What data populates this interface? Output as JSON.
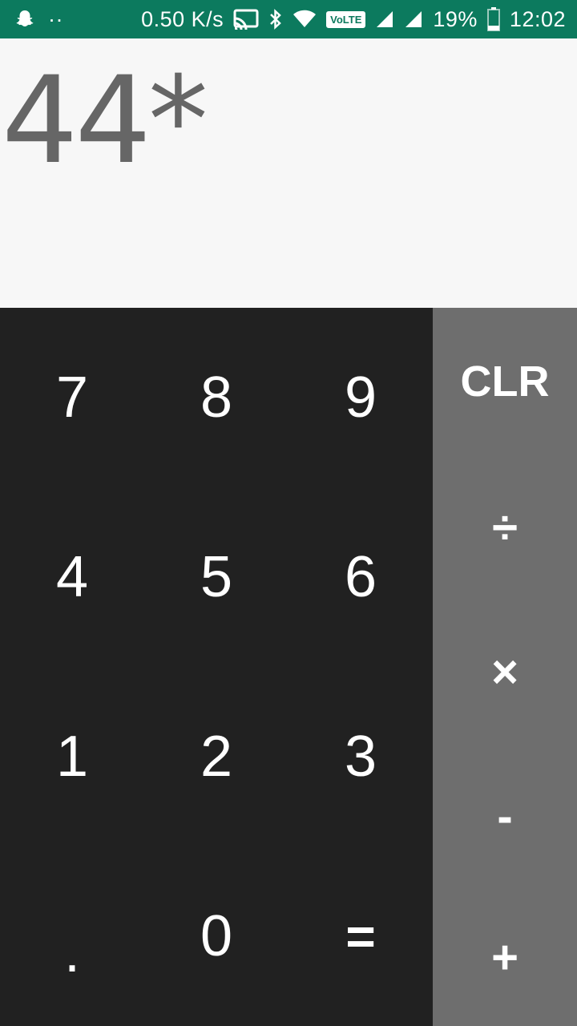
{
  "status_bar": {
    "network_speed": "0.50 K/s",
    "dots": "··",
    "volte": "VoLTE",
    "battery": "19%",
    "time": "12:02",
    "icons": [
      "snapchat-icon",
      "cast-icon",
      "bluetooth-icon",
      "wifi-icon",
      "volte-icon",
      "signal-icon",
      "signal-icon",
      "battery-icon"
    ]
  },
  "display": {
    "expression": "44*"
  },
  "keypad": {
    "rows": [
      [
        "7",
        "8",
        "9"
      ],
      [
        "4",
        "5",
        "6"
      ],
      [
        "1",
        "2",
        "3"
      ],
      [
        ".",
        "0",
        "="
      ]
    ]
  },
  "operators": {
    "clear": "CLR",
    "divide": "÷",
    "multiply": "×",
    "subtract": "-",
    "add": "+"
  },
  "colors": {
    "status_bar": "#0c7a5e",
    "display_bg": "#f7f7f7",
    "display_text": "#666666",
    "keypad_bg": "#212121",
    "ops_bg": "#6e6e6e",
    "key_text": "#ffffff"
  }
}
